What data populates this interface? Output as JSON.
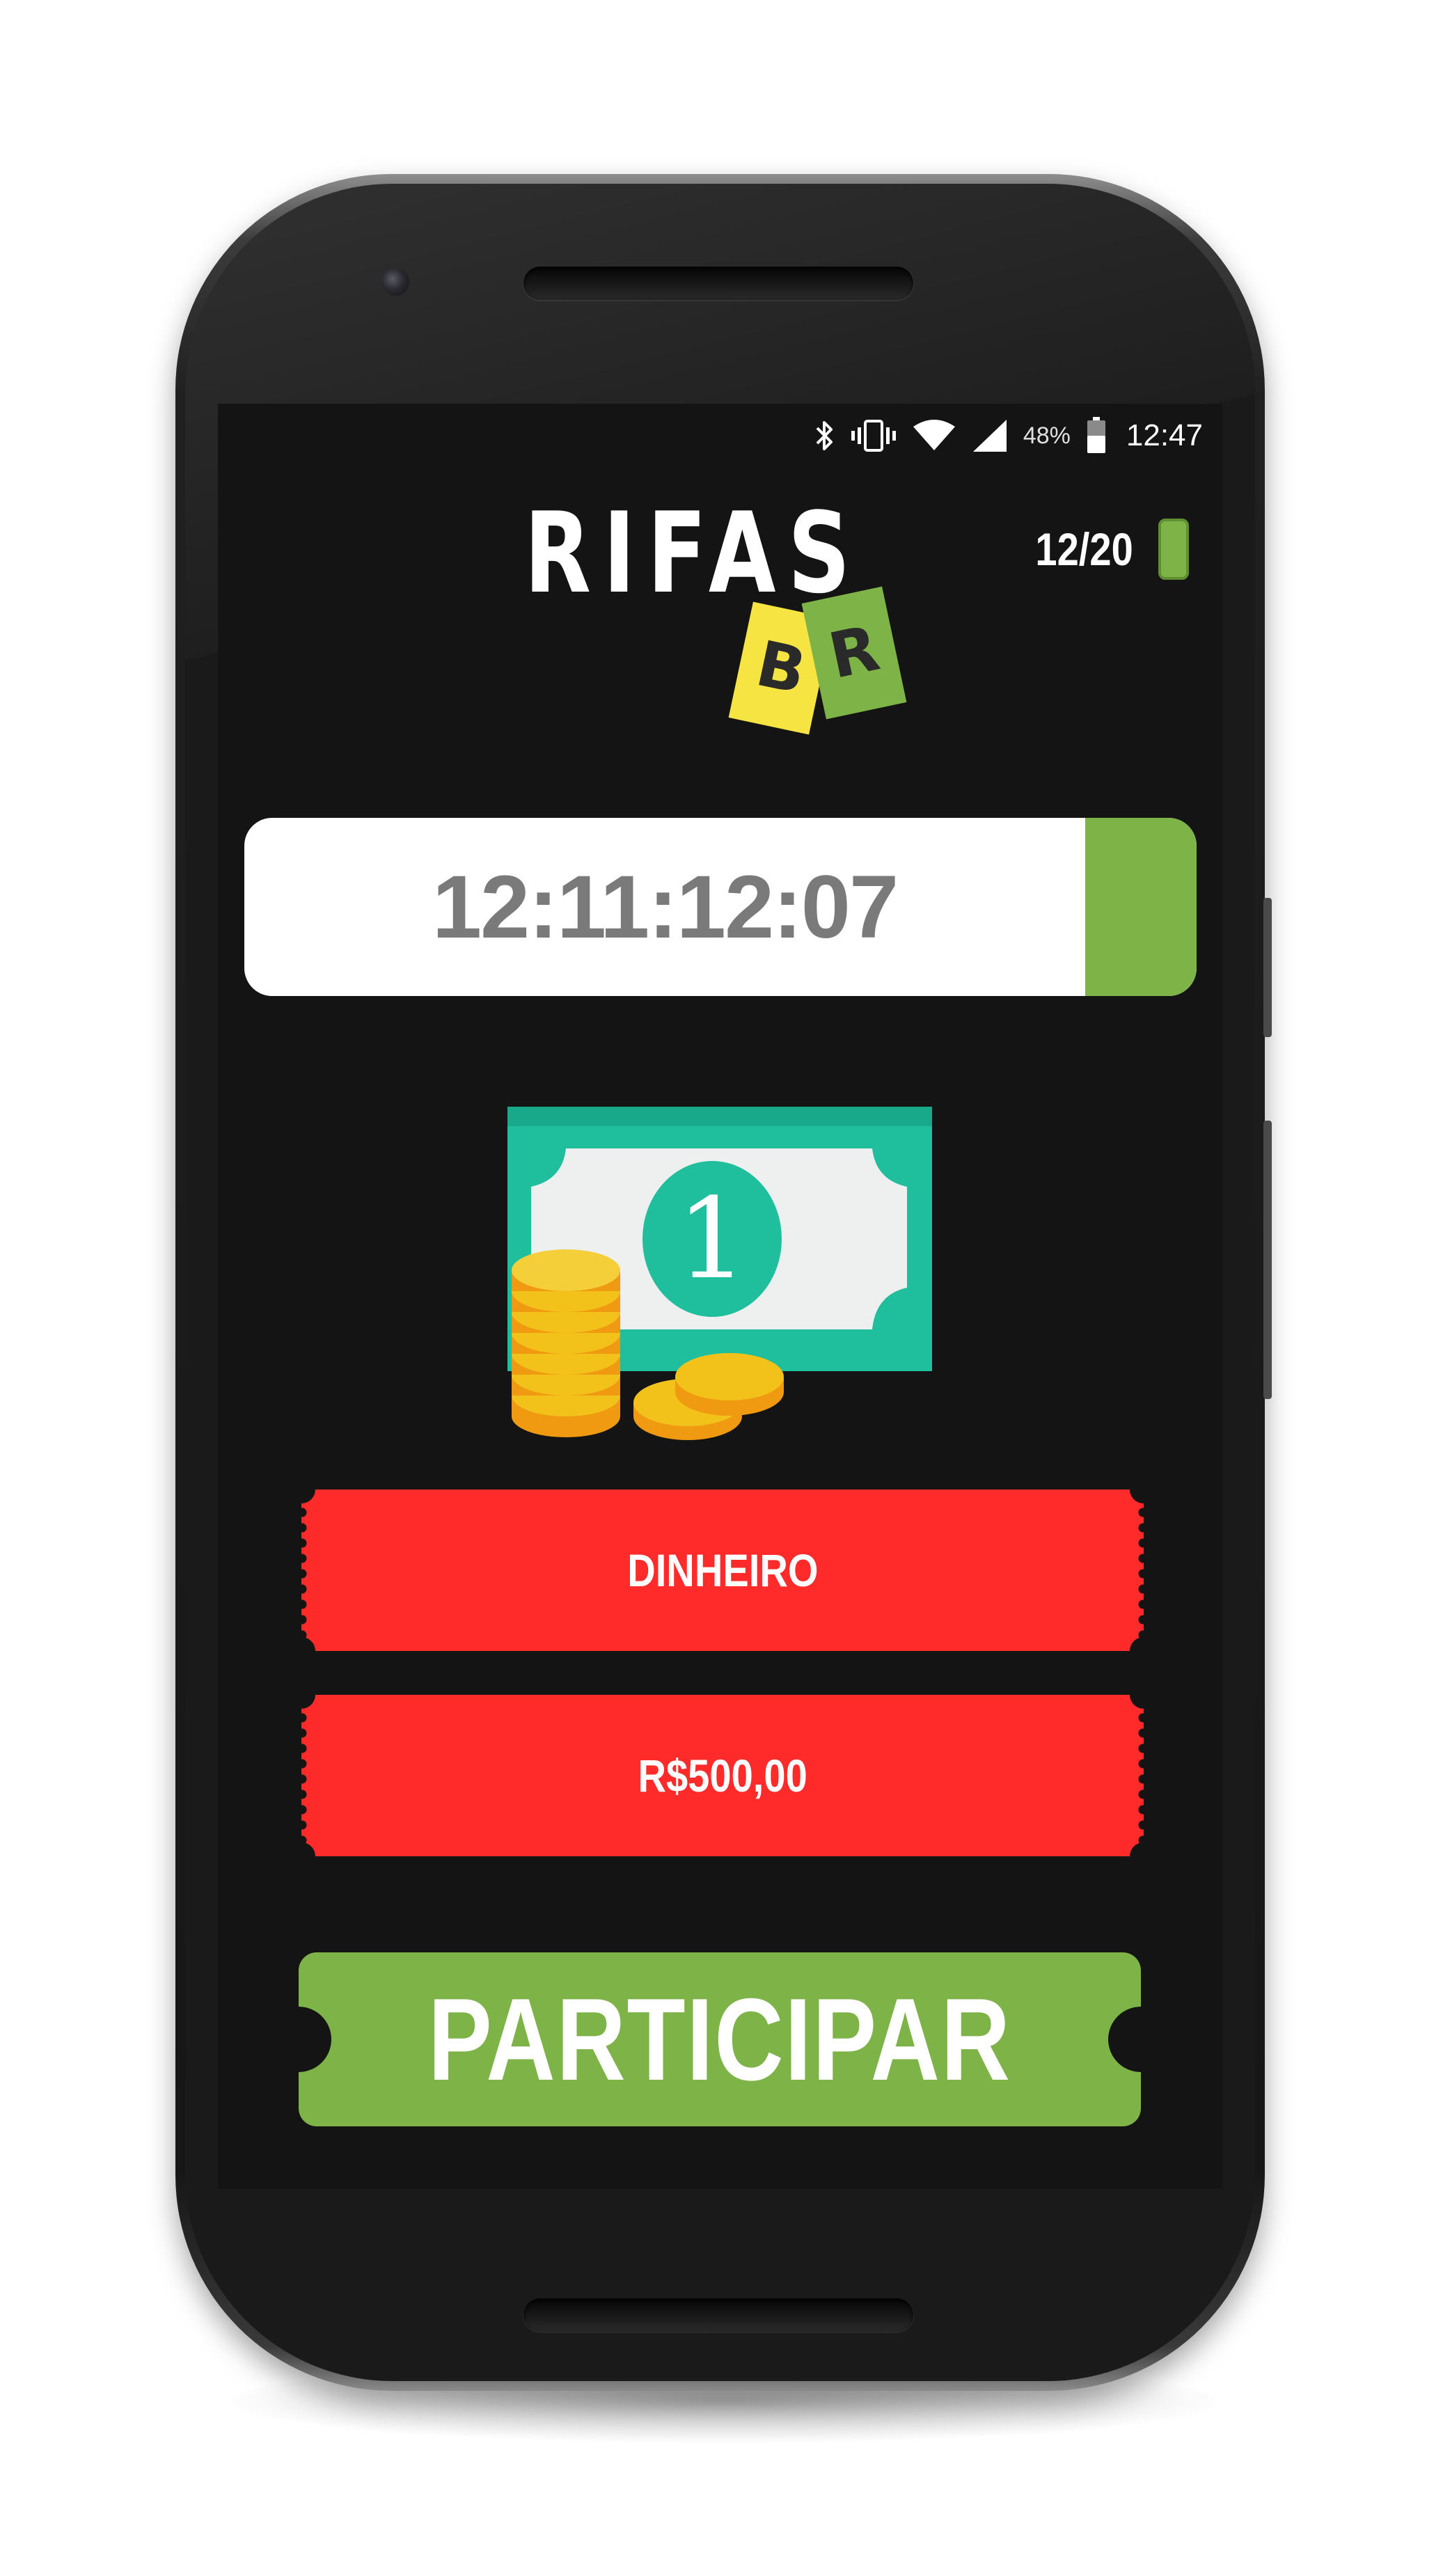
{
  "status_bar": {
    "battery_percent": "48%",
    "time": "12:47",
    "icons": [
      "bluetooth-icon",
      "vibrate-icon",
      "wifi-icon",
      "cell-signal-icon",
      "battery-icon"
    ]
  },
  "header": {
    "logo_word": "RIFAS",
    "logo_tag_left": "B",
    "logo_tag_right": "R",
    "counter": "12/20",
    "counter_icon": "ticket-icon"
  },
  "timer": {
    "value": "12:11:12:07"
  },
  "prize": {
    "image_icon": "money-bill-and-coins-icon",
    "bill_number": "1",
    "type_label": "DINHEIRO",
    "value_label": "R$500,00"
  },
  "actions": {
    "participate_label": "PARTICIPAR"
  },
  "colors": {
    "background": "#141414",
    "accent_green": "#7eb347",
    "ticket_red": "#ff2b2b",
    "logo_yellow": "#f5e441",
    "bill_teal": "#1fbf9e",
    "coin_gold": "#f2c21b"
  }
}
